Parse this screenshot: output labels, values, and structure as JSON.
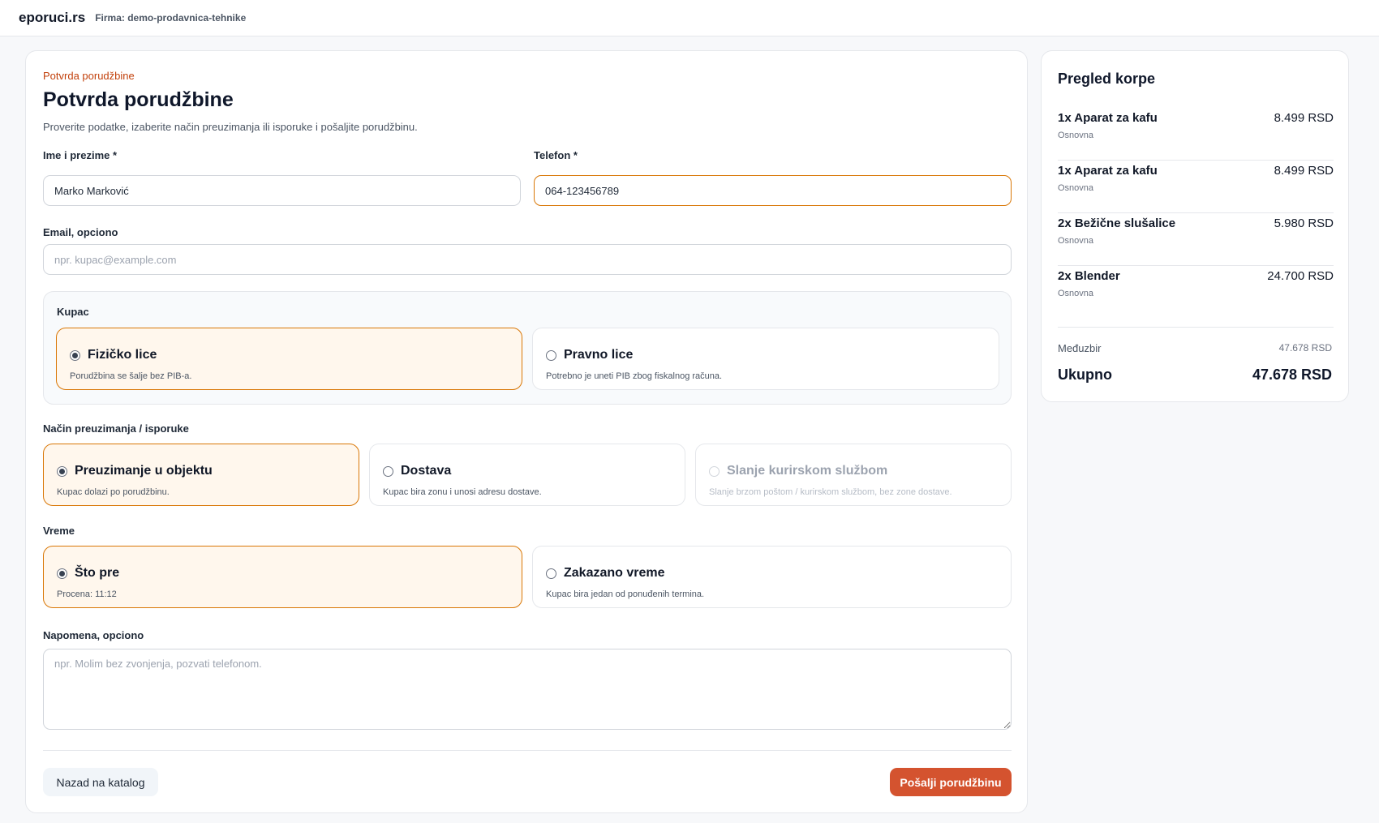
{
  "header": {
    "brand": "eporuci.rs",
    "firm": "Firma: demo-prodavnica-tehnike"
  },
  "form": {
    "breadcrumb": "Potvrda porudžbine",
    "title": "Potvrda porudžbine",
    "subtitle": "Proverite podatke, izaberite način preuzimanja ili isporuke i pošaljite porudžbinu.",
    "name": {
      "label": "Ime i prezime *",
      "value": "Marko Marković"
    },
    "phone": {
      "label": "Telefon *",
      "value": "064-123456789"
    },
    "email": {
      "label": "Email, opciono",
      "placeholder": "npr. kupac@example.com",
      "value": ""
    },
    "customer": {
      "label": "Kupac",
      "options": [
        {
          "title": "Fizičko lice",
          "desc": "Porudžbina se šalje bez PIB-a.",
          "selected": true
        },
        {
          "title": "Pravno lice",
          "desc": "Potrebno je uneti PIB zbog fiskalnog računa.",
          "selected": false
        }
      ]
    },
    "delivery": {
      "label": "Način preuzimanja / isporuke",
      "options": [
        {
          "title": "Preuzimanje u objektu",
          "desc": "Kupac dolazi po porudžbinu.",
          "selected": true
        },
        {
          "title": "Dostava",
          "desc": "Kupac bira zonu i unosi adresu dostave.",
          "selected": false
        },
        {
          "title": "Slanje kurirskom službom",
          "desc": "Slanje brzom poštom / kurirskom službom, bez zone dostave.",
          "selected": false,
          "disabled": true
        }
      ]
    },
    "time": {
      "label": "Vreme",
      "options": [
        {
          "title": "Što pre",
          "desc": "Procena: 11:12",
          "selected": true
        },
        {
          "title": "Zakazano vreme",
          "desc": "Kupac bira jedan od ponuđenih termina.",
          "selected": false
        }
      ]
    },
    "note": {
      "label": "Napomena, opciono",
      "placeholder": "npr. Molim bez zvonjenja, pozvati telefonom.",
      "value": ""
    },
    "back_label": "Nazad na katalog",
    "submit_label": "Pošalji porudžbinu"
  },
  "cart": {
    "title": "Pregled korpe",
    "items": [
      {
        "name": "1x Aparat za kafu",
        "variant": "Osnovna",
        "price": "8.499 RSD"
      },
      {
        "name": "1x Aparat za kafu",
        "variant": "Osnovna",
        "price": "8.499 RSD"
      },
      {
        "name": "2x Bežične slušalice",
        "variant": "Osnovna",
        "price": "5.980 RSD"
      },
      {
        "name": "2x Blender",
        "variant": "Osnovna",
        "price": "24.700 RSD"
      }
    ],
    "subtotal_label": "Međuzbir",
    "subtotal_value": "47.678 RSD",
    "total_label": "Ukupno",
    "total_value": "47.678 RSD"
  },
  "colors": {
    "accent": "#d97706",
    "accent_bg": "#fff7ed",
    "submit": "#d4532f",
    "breadcrumb": "#c2410c"
  }
}
